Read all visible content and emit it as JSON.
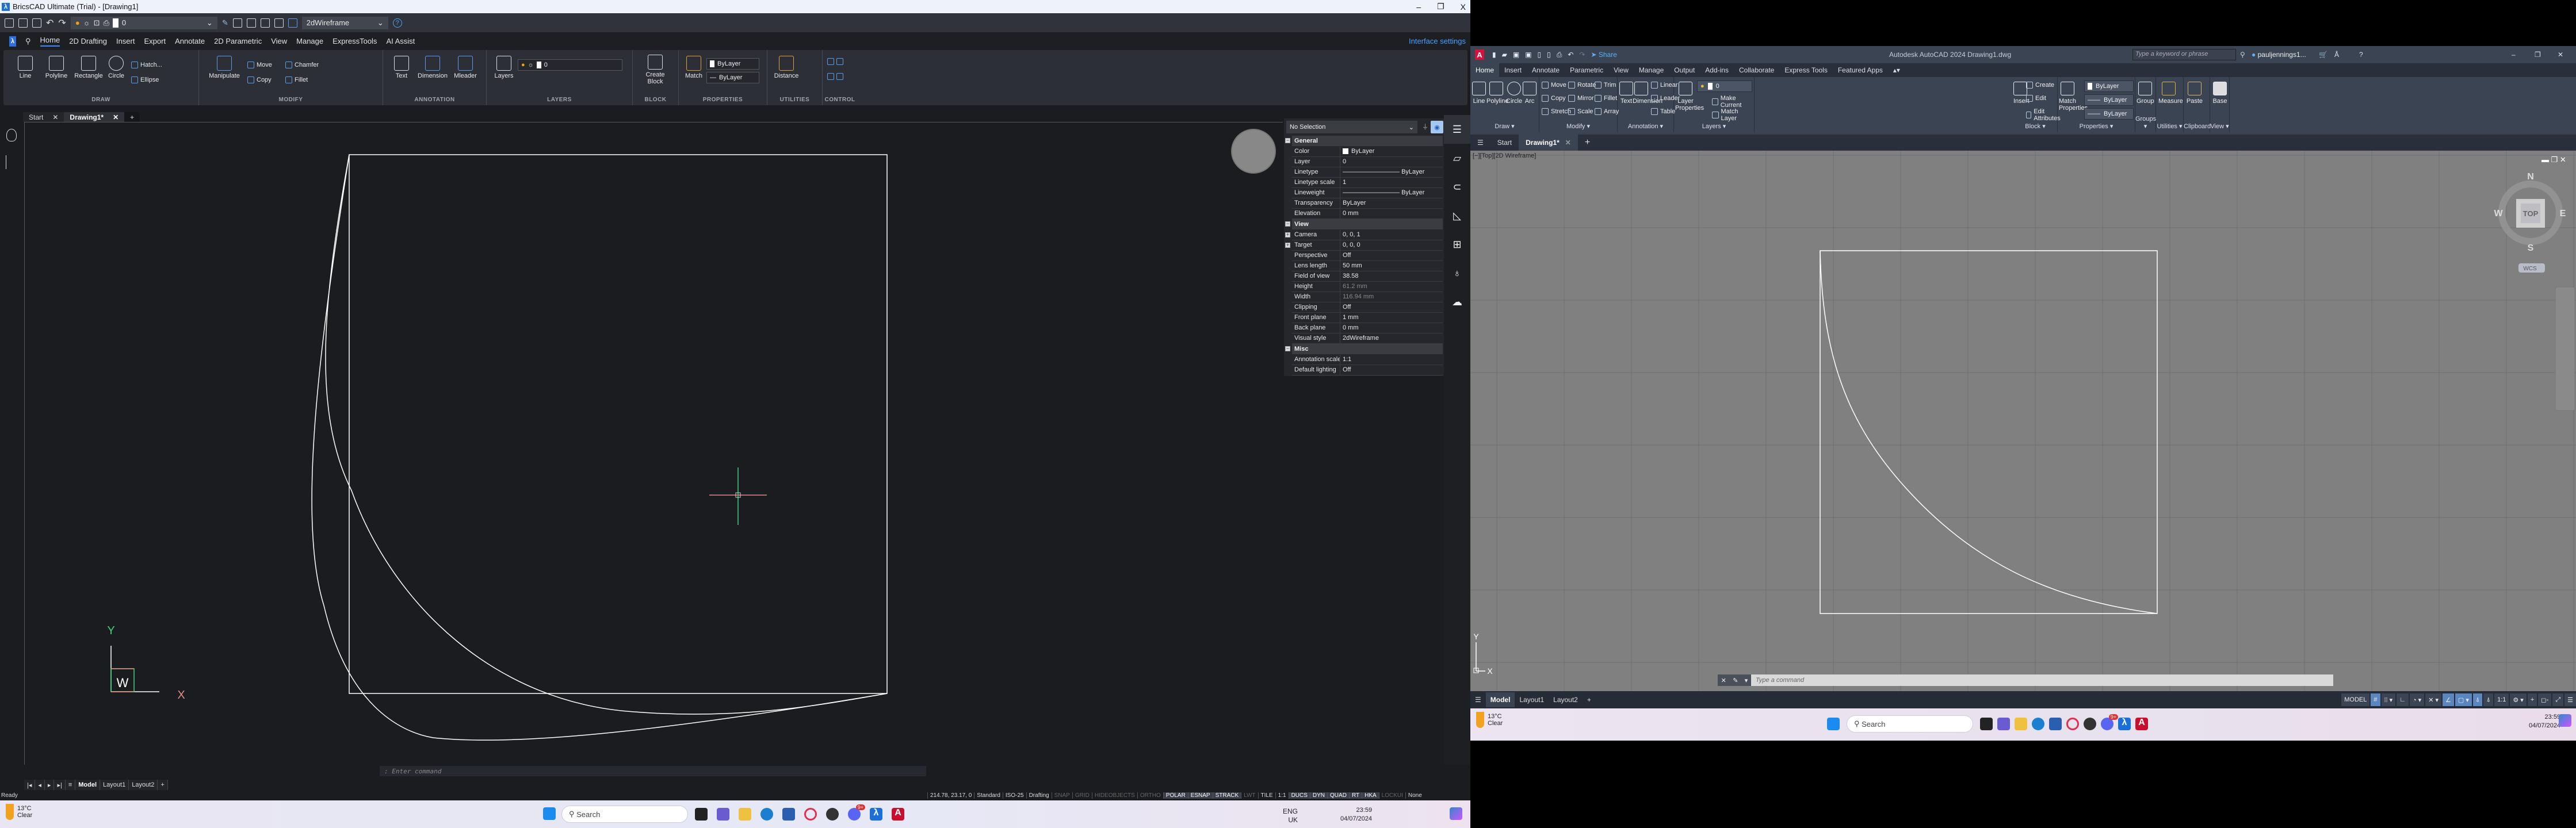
{
  "bricscad": {
    "title": "BricsCAD Ultimate (Trial) - [Drawing1]",
    "window_controls": [
      "–",
      "❐",
      "X"
    ],
    "qat": {
      "layer_value": "0",
      "visual_style": "2dWireframe"
    },
    "ribbon_tabs": [
      "Home",
      "2D Drafting",
      "Insert",
      "Export",
      "Annotate",
      "2D Parametric",
      "View",
      "Manage",
      "ExpressTools",
      "AI Assist"
    ],
    "active_tab": "Home",
    "interface_settings": "Interface settings",
    "groups": {
      "draw": {
        "label": "DRAW",
        "buttons": [
          "Line",
          "Polyline",
          "Rectangle",
          "Circle"
        ],
        "small": [
          "Hatch...",
          "Ellipse"
        ]
      },
      "modify": {
        "label": "MODIFY",
        "buttons": [
          "Manipulate"
        ],
        "small": [
          "Move",
          "Copy",
          "Chamfer",
          "Fillet"
        ]
      },
      "annotation": {
        "label": "ANNOTATION",
        "buttons": [
          "Text",
          "Dimension",
          "Mleader"
        ]
      },
      "layers": {
        "label": "LAYERS",
        "buttons": [
          "Layers"
        ],
        "layer_value": "0"
      },
      "block": {
        "label": "BLOCK",
        "buttons": [
          "Create Block"
        ]
      },
      "properties": {
        "label": "PROPERTIES",
        "buttons": [
          "Match"
        ],
        "color": "ByLayer",
        "linetype": "ByLayer"
      },
      "utilities": {
        "label": "UTILITIES",
        "buttons": [
          "Distance"
        ]
      },
      "control": {
        "label": "CONTROL"
      }
    },
    "doc_tabs": [
      {
        "label": "Start"
      },
      {
        "label": "Drawing1*",
        "active": true
      }
    ],
    "command_prompt": ": Enter command",
    "layout_tabs": [
      "Model",
      "Layout1",
      "Layout2",
      "+"
    ],
    "status": {
      "ready": "Ready",
      "coords": "214.78, 23.17, 0",
      "items": [
        {
          "label": "Standard",
          "state": "plain"
        },
        {
          "label": "ISO-25",
          "state": "plain"
        },
        {
          "label": "Drafting",
          "state": "plain"
        },
        {
          "label": "SNAP",
          "state": "off"
        },
        {
          "label": "GRID",
          "state": "off"
        },
        {
          "label": "HIDEOBJECTS",
          "state": "off"
        },
        {
          "label": "ORTHO",
          "state": "off"
        },
        {
          "label": "POLAR",
          "state": "on"
        },
        {
          "label": "ESNAP",
          "state": "on"
        },
        {
          "label": "STRACK",
          "state": "on"
        },
        {
          "label": "LWT",
          "state": "off"
        },
        {
          "label": "TILE",
          "state": "plain"
        },
        {
          "label": "1:1",
          "state": "plain"
        },
        {
          "label": "DUCS",
          "state": "on"
        },
        {
          "label": "DYN",
          "state": "on"
        },
        {
          "label": "QUAD",
          "state": "on"
        },
        {
          "label": "RT",
          "state": "on"
        },
        {
          "label": "HKA",
          "state": "on"
        },
        {
          "label": "LOCKUI",
          "state": "off"
        },
        {
          "label": "None",
          "state": "plain"
        }
      ]
    },
    "ucs": {
      "x": "X",
      "y": "Y",
      "w": "W"
    },
    "properties_panel": {
      "selection": "No Selection",
      "sections": [
        {
          "title": "General",
          "rows": [
            {
              "k": "Color",
              "v": "ByLayer"
            },
            {
              "k": "Layer",
              "v": "0"
            },
            {
              "k": "Linetype",
              "v": "ByLayer"
            },
            {
              "k": "Linetype scale",
              "v": "1"
            },
            {
              "k": "Lineweight",
              "v": "ByLayer"
            },
            {
              "k": "Transparency",
              "v": "ByLayer"
            },
            {
              "k": "Elevation",
              "v": "0 mm"
            }
          ]
        },
        {
          "title": "View",
          "rows": [
            {
              "k": "Camera",
              "v": "0, 0, 1"
            },
            {
              "k": "Target",
              "v": "0, 0, 0"
            },
            {
              "k": "Perspective",
              "v": "Off"
            },
            {
              "k": "Lens length",
              "v": "50 mm"
            },
            {
              "k": "Field of view",
              "v": "38.58"
            },
            {
              "k": "Height",
              "v": "61.2 mm",
              "dim": true
            },
            {
              "k": "Width",
              "v": "116.94 mm",
              "dim": true
            },
            {
              "k": "Clipping",
              "v": "Off"
            },
            {
              "k": "Front plane",
              "v": "1 mm"
            },
            {
              "k": "Back plane",
              "v": "0 mm"
            },
            {
              "k": "Visual style",
              "v": "2dWireframe"
            }
          ]
        },
        {
          "title": "Misc",
          "rows": [
            {
              "k": "Annotation scale",
              "v": "1:1"
            },
            {
              "k": "Default lighting",
              "v": "Off"
            }
          ]
        }
      ]
    }
  },
  "autocad": {
    "title": "Autodesk AutoCAD 2024    Drawing1.dwg",
    "search_placeholder": "Type a keyword or phrase",
    "user": "pauljennings1...",
    "share": "Share",
    "ribbon_tabs": [
      "Home",
      "Insert",
      "Annotate",
      "Parametric",
      "View",
      "Manage",
      "Output",
      "Add-ins",
      "Collaborate",
      "Express Tools",
      "Featured Apps"
    ],
    "active_tab": "Home",
    "groups": {
      "draw": {
        "label": "Draw ▾",
        "buttons": [
          "Line",
          "Polyline",
          "Circle",
          "Arc"
        ]
      },
      "modify": {
        "label": "Modify ▾",
        "small": [
          "Move",
          "Rotate",
          "Trim",
          "Copy",
          "Mirror",
          "Fillet",
          "Stretch",
          "Scale",
          "Array"
        ]
      },
      "annotation": {
        "label": "Annotation ▾",
        "buttons": [
          "Text",
          "Dimension"
        ],
        "small": [
          "Linear",
          "Leader",
          "Table"
        ]
      },
      "layers": {
        "label": "Layers ▾",
        "buttons": [
          "Layer Properties"
        ],
        "layer_value": "0",
        "small": [
          "Make Current",
          "Match Layer"
        ]
      },
      "block": {
        "label": "Block ▾",
        "buttons": [
          "Insert"
        ],
        "small": [
          "Create",
          "Edit",
          "Edit Attributes"
        ]
      },
      "properties": {
        "label": "Properties ▾",
        "buttons": [
          "Match Properties"
        ],
        "combos": [
          "ByLayer",
          "ByLayer",
          "ByLayer"
        ]
      },
      "groups": {
        "label": "Groups ▾",
        "buttons": [
          "Group"
        ]
      },
      "utilities": {
        "label": "Utilities ▾",
        "buttons": [
          "Measure"
        ]
      },
      "clipboard": {
        "label": "Clipboard",
        "buttons": [
          "Paste"
        ]
      },
      "view": {
        "label": "View ▾",
        "buttons": [
          "Base"
        ]
      }
    },
    "doc_tabs": [
      "Start",
      "Drawing1*"
    ],
    "viewport_label": "[−][Top][2D Wireframe]",
    "viewcube": {
      "face": "TOP",
      "n": "N",
      "s": "S",
      "e": "E",
      "w": "W",
      "ucs": "WCS"
    },
    "command_placeholder": "Type a command",
    "layout_tabs": [
      "Model",
      "Layout1",
      "Layout2",
      "+"
    ],
    "status": {
      "model": "MODEL",
      "scale": "1:1"
    }
  },
  "taskbar": {
    "weather_temp": "13°C",
    "weather_desc": "Clear",
    "search": "Search",
    "language": "ENG",
    "region": "UK",
    "time": "23:59",
    "date": "04/07/2024",
    "discord_badge": "9+",
    "weather_badge": "1"
  }
}
